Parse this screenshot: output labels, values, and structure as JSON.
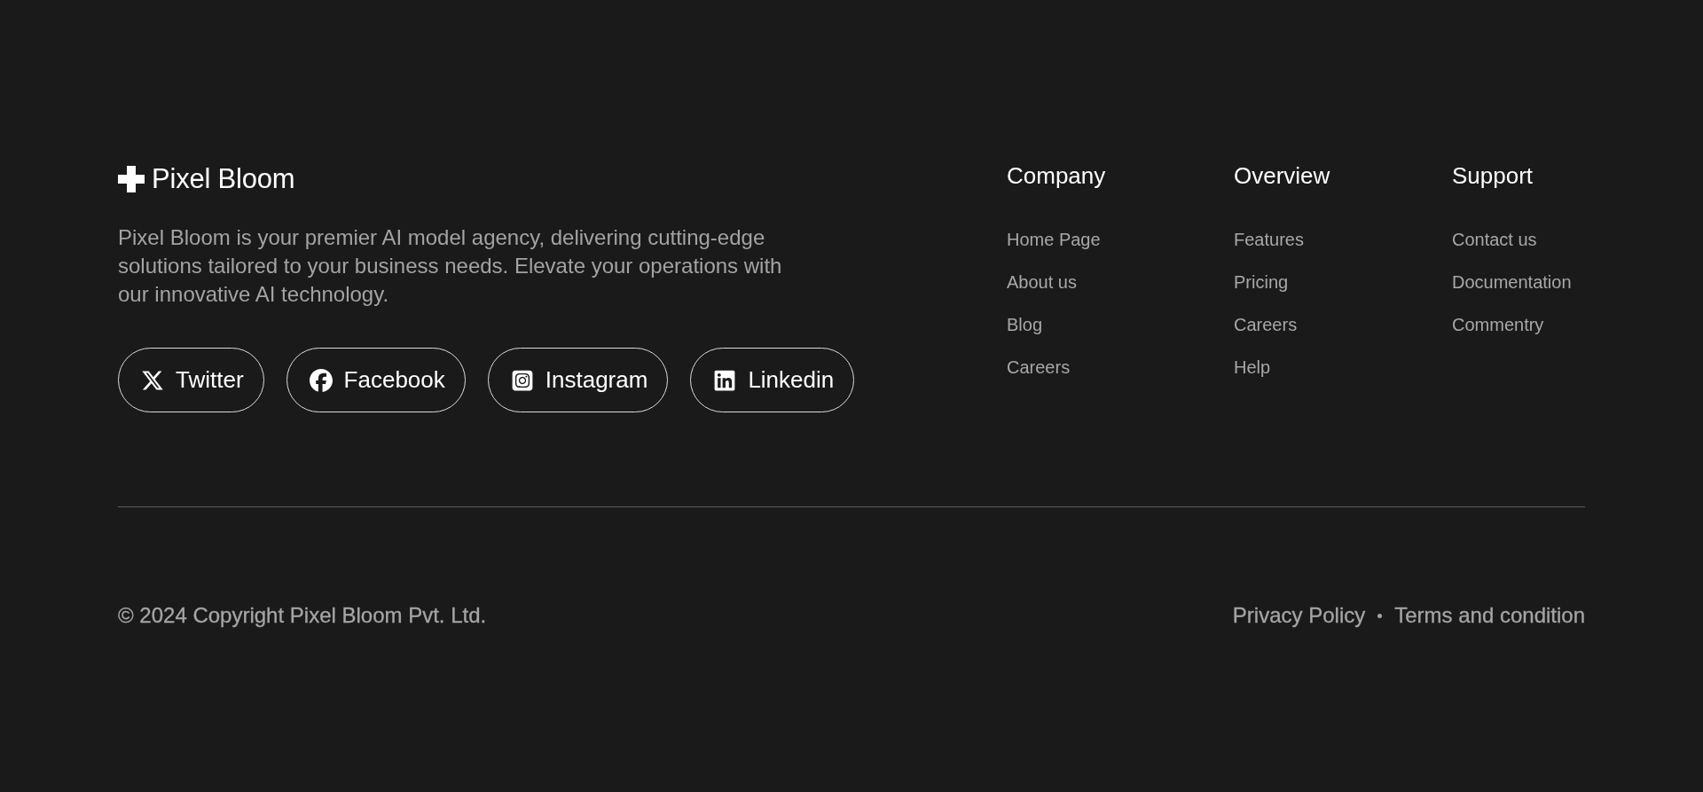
{
  "brand": {
    "name": "Pixel Bloom",
    "description": "Pixel Bloom is your premier AI model agency, delivering cutting-edge solutions tailored to your business needs. Elevate your operations with our innovative AI technology."
  },
  "socials": [
    {
      "kind": "x",
      "label": "Twitter"
    },
    {
      "kind": "facebook",
      "label": "Facebook"
    },
    {
      "kind": "instagram",
      "label": "Instagram"
    },
    {
      "kind": "linkedin",
      "label": "Linkedin"
    }
  ],
  "columns": [
    {
      "title": "Company",
      "links": [
        "Home Page",
        "About us",
        "Blog",
        "Careers"
      ]
    },
    {
      "title": "Overview",
      "links": [
        "Features",
        "Pricing",
        "Careers",
        "Help"
      ]
    },
    {
      "title": "Support",
      "links": [
        "Contact us",
        "Documentation",
        "Commentry"
      ]
    }
  ],
  "copyright": "© 2024 Copyright Pixel Bloom Pvt. Ltd.",
  "legal_links": [
    "Privacy Policy",
    "Terms and condition"
  ]
}
